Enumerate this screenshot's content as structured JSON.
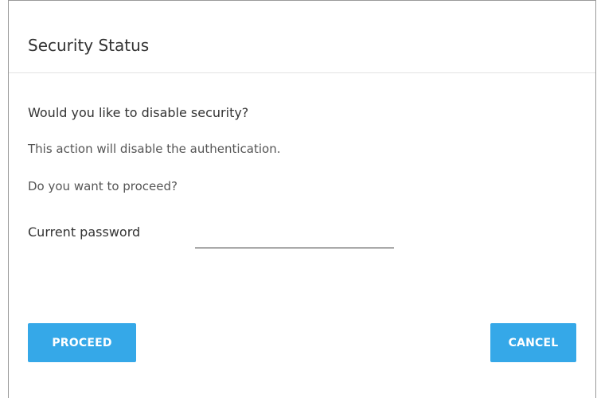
{
  "dialog": {
    "title": "Security Status",
    "question": "Would you like to disable security?",
    "message_line1": "This action will disable the authentication.",
    "message_line2": "Do you want to proceed?",
    "password": {
      "label": "Current password",
      "value": "",
      "placeholder": ""
    },
    "buttons": {
      "proceed_label": "PROCEED",
      "cancel_label": "CANCEL"
    }
  },
  "colors": {
    "button_accent": "#35a8e8",
    "button_text": "#ffffff",
    "border": "#9a9a9a"
  }
}
